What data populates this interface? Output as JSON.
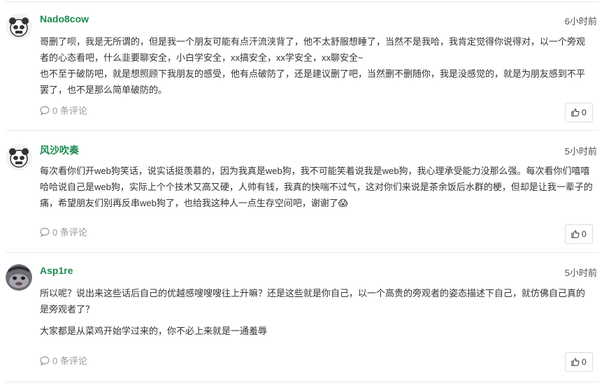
{
  "comments": [
    {
      "author": "Nado8cow",
      "time": "6小时前",
      "paragraphs": [
        "哥删了呗，我是无所谓的，但是我一个朋友可能有点汗流浃背了，他不太舒服想睡了，当然不是我哈，我肯定觉得你说得对，以一个旁观者的心态看吧，什么韭要聊安全，小白学安全，xx搞安全，xx学安全，xx聊安全~",
        "也不至于破防吧，就是想照顾下我朋友的感受，他有点破防了，还是建议删了吧，当然删不删随你，我是没感觉的，就是为朋友感到不平罢了，也不是那么简单破防的。"
      ],
      "reply_label": "0 条评论",
      "like_count": "0"
    },
    {
      "author": "风沙吹奏",
      "time": "5小时前",
      "paragraphs": [
        "每次看你们开web狗笑话，说实话挺羡慕的，因为我真是web狗，我不可能笑着说我是web狗，我心理承受能力没那么强。每次看你们嘻嘻哈哈说自己是web狗，实际上个个技术又高又硬，人帅有钱，我真的快喘不过气，这对你们来说是茶余饭后水群的梗，但却是让我一辈子的痛，希望朋友们别再反串web狗了，也给我这种人一点生存空间吧，谢谢了😱"
      ],
      "reply_label": "0 条评论",
      "like_count": "0"
    },
    {
      "author": "Asp1re",
      "time": "5小时前",
      "paragraphs": [
        "所以呢？说出来这些话后自己的优越感嗖嗖嗖往上升嘛？还是这些就是你自己，以一个高贵的旁观者的姿态描述下自己，就仿佛自己真的是旁观者了？",
        "大家都是从菜鸡开始学过来的，你不必上来就是一通羞辱"
      ],
      "reply_label": "0 条评论",
      "like_count": "0"
    }
  ],
  "colors": {
    "author": "#1a8a4f",
    "muted": "#999999",
    "divider": "#e8e8e8"
  },
  "icons": {
    "reply": "comment-bubble-icon",
    "like": "thumbs-up-icon"
  }
}
